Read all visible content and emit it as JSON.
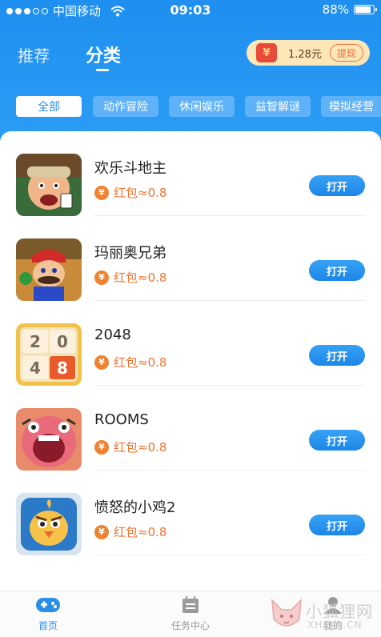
{
  "status_bar": {
    "carrier": "中国移动",
    "time": "09:03",
    "battery": "88%",
    "battery_level": 0.88
  },
  "header": {
    "tabs": [
      {
        "label": "推荐",
        "active": false
      },
      {
        "label": "分类",
        "active": true
      }
    ],
    "reward": {
      "icon": "¥",
      "amount": "1.28元",
      "withdraw_label": "提现"
    }
  },
  "categories": [
    {
      "label": "全部",
      "active": true
    },
    {
      "label": "动作冒险",
      "active": false
    },
    {
      "label": "休闲娱乐",
      "active": false
    },
    {
      "label": "益智解谜",
      "active": false
    },
    {
      "label": "模拟经营",
      "active": false
    }
  ],
  "games": [
    {
      "name": "欢乐斗地主",
      "reward": "红包≈0.8",
      "action": "打开",
      "icon": "landlord-game-icon"
    },
    {
      "name": "玛丽奥兄弟",
      "reward": "红包≈0.8",
      "action": "打开",
      "icon": "mario-game-icon"
    },
    {
      "name": "2048",
      "reward": "红包≈0.8",
      "action": "打开",
      "icon": "tiles-2048-game-icon"
    },
    {
      "name": "ROOMS",
      "reward": "红包≈0.8",
      "action": "打开",
      "icon": "rooms-game-icon"
    },
    {
      "name": "愤怒的小鸡2",
      "reward": "红包≈0.8",
      "action": "打开",
      "icon": "angry-chick-game-icon"
    }
  ],
  "tile_2048": [
    "2",
    "0",
    "4",
    "8"
  ],
  "reward_coin": "¥",
  "bottom_nav": [
    {
      "label": "首页",
      "icon": "gamepad-icon",
      "active": true
    },
    {
      "label": "任务中心",
      "icon": "calendar-icon",
      "active": false
    },
    {
      "label": "我的",
      "icon": "person-icon",
      "active": false
    }
  ],
  "watermark": {
    "line1": "小狐狸网",
    "line2": "XHLKS.CN"
  },
  "colors": {
    "header_blue": "#1f8ff0",
    "accent_blue": "#2a8de8",
    "reward_orange": "#f0722b",
    "reward_pill_bg": "#fde7b8"
  }
}
